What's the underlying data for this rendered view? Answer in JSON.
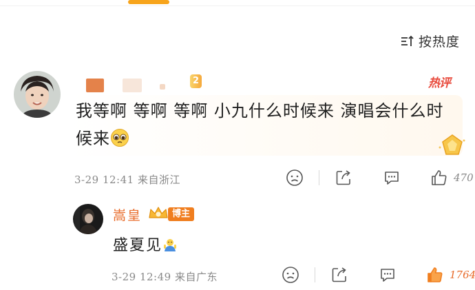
{
  "sort": {
    "label": "按热度",
    "icon": "sort-icon"
  },
  "comments": [
    {
      "user": {
        "level_badge": "2",
        "avatar": "avatar-young-man"
      },
      "hot_badge": "热评",
      "text": "我等啊 等啊 等啊 小九什么时候来 演唱会什么时候来",
      "emoji": "pleading-face",
      "timestamp": "3-29 12:41",
      "location": "来自浙江",
      "likes": "470",
      "liked": false
    }
  ],
  "reply": {
    "name": "嵩皇",
    "badge": "博主",
    "text": "盛夏见",
    "emoji": "waving-person",
    "timestamp": "3-29 12:49",
    "location": "来自广东",
    "likes": "1764",
    "liked": true
  },
  "colors": {
    "accent": "#e86b2a",
    "hot_red": "#e84a3c",
    "tab_indicator": "#f7a41b",
    "meta_gray": "#888888"
  }
}
